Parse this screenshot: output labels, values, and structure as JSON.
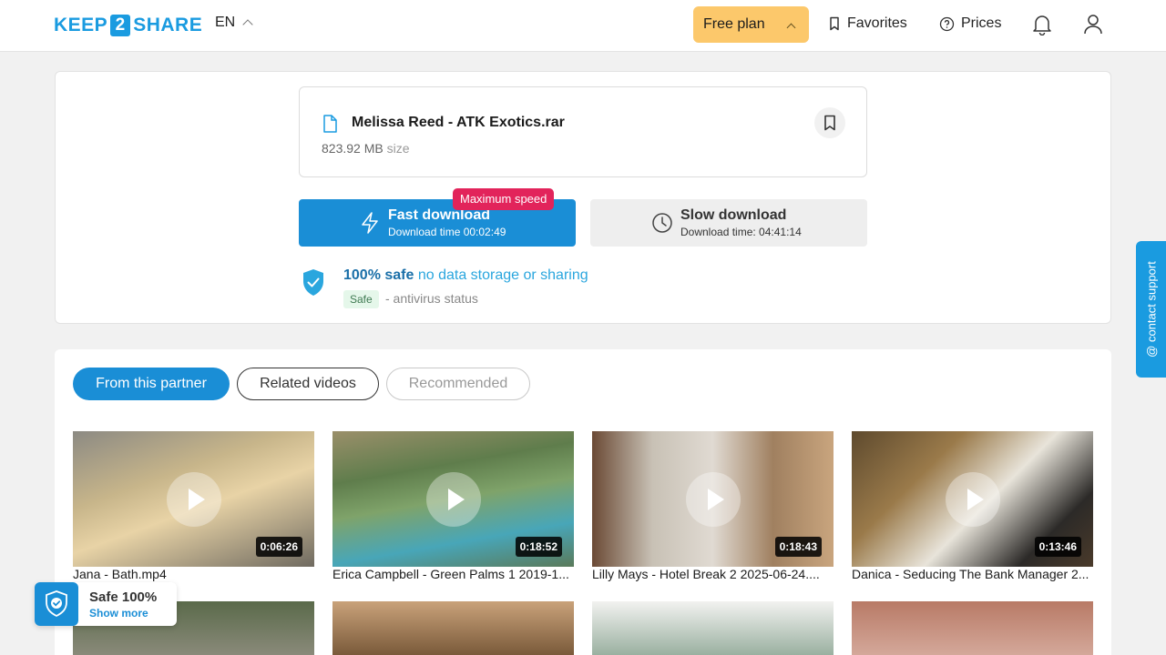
{
  "header": {
    "logo_left": "KEEP",
    "logo_num": "2",
    "logo_right": "SHARE",
    "lang": "EN",
    "plan": "Free plan",
    "favorites": "Favorites",
    "prices": "Prices"
  },
  "file": {
    "name": "Melissa Reed - ATK Exotics.rar",
    "size": "823.92 MB",
    "size_unit": "size"
  },
  "download": {
    "fast_title": "Fast download",
    "fast_sub": "Download time 00:02:49",
    "badge": "Maximum speed",
    "slow_title": "Slow download",
    "slow_sub": "Download time: 04:41:14"
  },
  "safety": {
    "bold": "100% safe",
    "rest": "no data storage or sharing",
    "badge": "Safe",
    "status": "- antivirus status"
  },
  "tabs": [
    "From this partner",
    "Related videos",
    "Recommended"
  ],
  "videos": [
    {
      "title": "Jana - Bath.mp4",
      "duration": "0:06:26"
    },
    {
      "title": "Erica Campbell - Green Palms 1 2019-1...",
      "duration": "0:18:52"
    },
    {
      "title": "Lilly Mays - Hotel Break 2 2025-06-24....",
      "duration": "0:18:43"
    },
    {
      "title": "Danica - Seducing The Bank Manager 2...",
      "duration": "0:13:46"
    }
  ],
  "contact": "@ contact support",
  "safe_widget": {
    "title": "Safe 100%",
    "more": "Show more"
  },
  "colors": {
    "accent": "#1a8ed6",
    "plan": "#fcc86b",
    "badge": "#e2245b"
  }
}
